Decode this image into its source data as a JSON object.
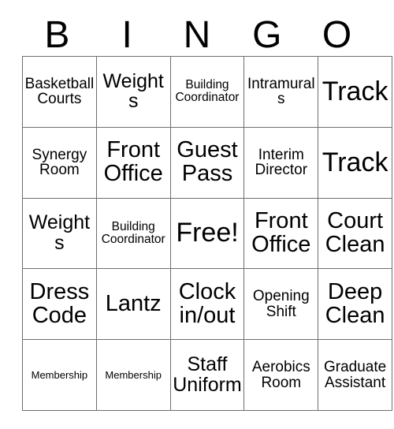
{
  "card": {
    "header_letters": [
      "B",
      "I",
      "N",
      "G",
      "O"
    ],
    "rows": [
      [
        {
          "text": "Basketball Courts",
          "size": "sz-md"
        },
        {
          "text": "Weights",
          "size": "sz-lg"
        },
        {
          "text": "Building Coordinator",
          "size": "sz-sm"
        },
        {
          "text": "Intramurals",
          "size": "sz-md"
        },
        {
          "text": "Track",
          "size": "sz-xxl"
        }
      ],
      [
        {
          "text": "Synergy Room",
          "size": "sz-md"
        },
        {
          "text": "Front Office",
          "size": "sz-xl"
        },
        {
          "text": "Guest Pass",
          "size": "sz-xl"
        },
        {
          "text": "Interim Director",
          "size": "sz-md"
        },
        {
          "text": "Track",
          "size": "sz-xxl"
        }
      ],
      [
        {
          "text": "Weights",
          "size": "sz-lg"
        },
        {
          "text": "Building Coordinator",
          "size": "sz-sm"
        },
        {
          "text": "Free!",
          "size": "sz-xxl"
        },
        {
          "text": "Front Office",
          "size": "sz-xl"
        },
        {
          "text": "Court Clean",
          "size": "sz-xl"
        }
      ],
      [
        {
          "text": "Dress Code",
          "size": "sz-xl"
        },
        {
          "text": "Lantz",
          "size": "sz-xl"
        },
        {
          "text": "Clock in/out",
          "size": "sz-xl"
        },
        {
          "text": "Opening Shift",
          "size": "sz-md"
        },
        {
          "text": "Deep Clean",
          "size": "sz-xl"
        }
      ],
      [
        {
          "text": "Membership",
          "size": "sz-xs"
        },
        {
          "text": "Membership",
          "size": "sz-xs"
        },
        {
          "text": "Staff Uniform",
          "size": "sz-lg"
        },
        {
          "text": "Aerobics Room",
          "size": "sz-md"
        },
        {
          "text": "Graduate Assistant",
          "size": "sz-md"
        }
      ]
    ]
  },
  "colors": {
    "grid_line": "#6e6e6e",
    "text": "#000000",
    "background": "#ffffff"
  }
}
